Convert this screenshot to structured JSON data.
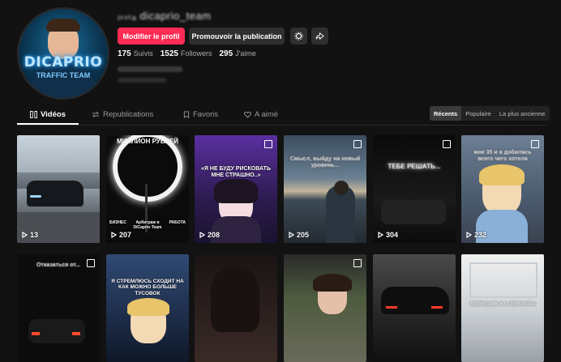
{
  "profile": {
    "avatar_logo": "DICAPRIO",
    "avatar_logo_sub": "TRAFFIC TEAM",
    "username": "ᵢₙₛₜₐ dicaprio_team",
    "edit_button": "Modifier le profil",
    "promote_button": "Promouvoir la publication",
    "settings_icon": "gear-icon",
    "share_icon": "share-icon",
    "stats": {
      "following_count": "175",
      "following_label": "Suivis",
      "followers_count": "1525",
      "followers_label": "Followers",
      "likes_count": "295",
      "likes_label": "J'aime"
    }
  },
  "tabs": [
    {
      "label": "Vidéos",
      "icon": "grid-icon",
      "active": true
    },
    {
      "label": "Republications",
      "icon": "repost-icon",
      "active": false
    },
    {
      "label": "Favoris",
      "icon": "bookmark-icon",
      "active": false
    },
    {
      "label": "A aimé",
      "icon": "heart-icon",
      "active": false
    }
  ],
  "sort": [
    "Récents",
    "Populaire",
    "La plus ancienne"
  ],
  "videos": [
    {
      "views": "13",
      "caption": "",
      "top_caption": ""
    },
    {
      "views": "207",
      "caption": "",
      "top_caption": "МИЛЛИОН РУБЛЕЙ",
      "sub_left": "БИЗНЕС",
      "sub_mid": "Арбитраж в DiCaprio Team",
      "sub_right": "РАБОТА"
    },
    {
      "views": "208",
      "caption": "«Я НЕ БУДУ РИСКОВАТЬ МНЕ СТРАШНО..»",
      "top_caption": ""
    },
    {
      "views": "205",
      "caption": "",
      "top_caption": "Смысл, выйду на новый уровень..."
    },
    {
      "views": "304",
      "caption": "",
      "top_caption": "ТЕБЕ РЕШАТЬ..."
    },
    {
      "views": "232",
      "caption": "",
      "top_caption": "мне 35 и я добилась всего чего хотела"
    },
    {
      "views": "",
      "caption": "",
      "top_caption": "Отказаться от..."
    },
    {
      "views": "",
      "caption": "Я СТРЕМЛЮСЬ СХОДИТ НА КАК МОЖНО БОЛЬШЕ ТУСОВОК",
      "top_caption": ""
    },
    {
      "views": "",
      "caption": "",
      "top_caption": ""
    },
    {
      "views": "",
      "caption": "",
      "top_caption": ""
    },
    {
      "views": "",
      "caption": "",
      "top_caption": ""
    },
    {
      "views": "",
      "caption": "Арбитраж на стрельбы",
      "top_caption": ""
    }
  ]
}
